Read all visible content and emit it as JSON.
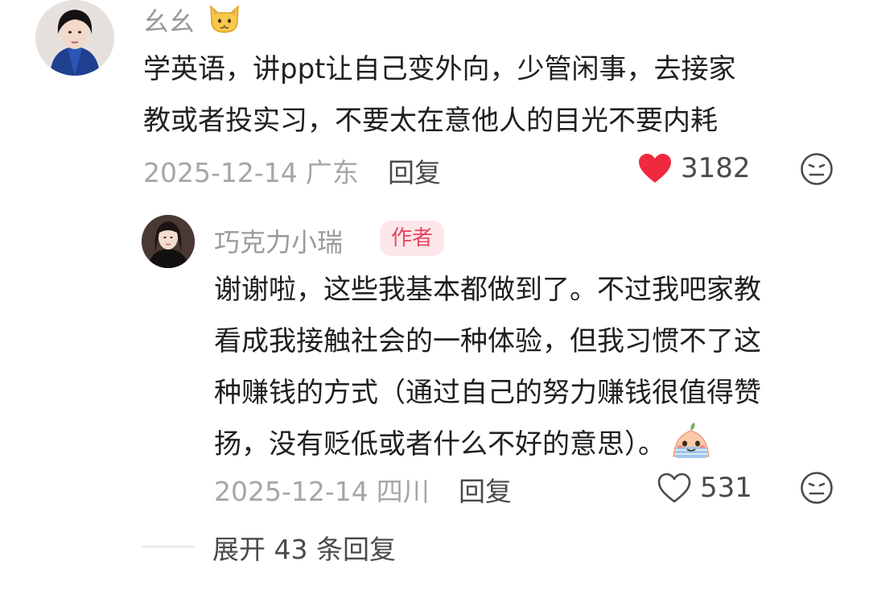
{
  "comment": {
    "username": "幺幺",
    "username_emoji": "cat-face-icon",
    "text_lines": [
      "学英语，讲ppt让自己变外向，少管闲事，去接家",
      "教或者投实习，不要太在意他人的目光不要内耗"
    ],
    "date": "2025-12-14",
    "region": "广东",
    "reply_label": "回复",
    "likes": "3182",
    "liked": true,
    "like_color": "#f0293e"
  },
  "reply": {
    "username": "巧克力小瑞",
    "badge": "作者",
    "badge_color": "#e8455f",
    "text_lines": [
      "谢谢啦，这些我基本都做到了。不过我吧家教",
      "看成我接触社会的一种体验，但我习惯不了这",
      "种赚钱的方式（通过自己的努力赚钱很值得赞",
      "扬，没有贬低或者什么不好的意思）。"
    ],
    "text_emoji": "blushing-face-icon",
    "date": "2025-12-14",
    "region": "四川",
    "reply_label": "回复",
    "likes": "531",
    "liked": false
  },
  "expand": {
    "label": "展开 43 条回复"
  }
}
